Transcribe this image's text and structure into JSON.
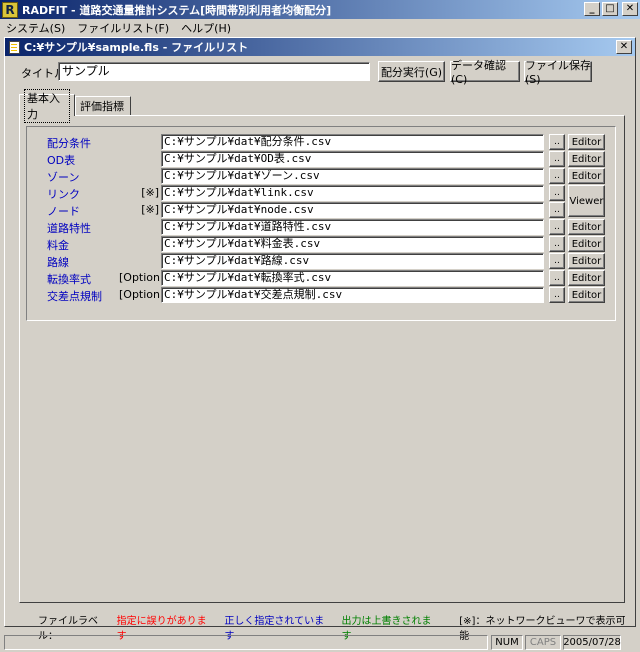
{
  "window": {
    "app_icon": "R",
    "title": "RADFIT - 道路交通量推計システム[時間帯別利用者均衡配分]",
    "controls": {
      "minimize": "_",
      "maximize": "□",
      "close": "✕"
    }
  },
  "menu": [
    {
      "label": "システム(S)"
    },
    {
      "label": "ファイルリスト(F)"
    },
    {
      "label": "ヘルプ(H)"
    }
  ],
  "child": {
    "title": "C:¥サンプル¥sample.fls - ファイルリスト",
    "close": "✕"
  },
  "form": {
    "title_label": "タイトル",
    "title_value": "サンプル",
    "buttons": {
      "run": "配分実行(G)",
      "check": "データ確認(C)",
      "save": "ファイル保存(S)"
    }
  },
  "tabs": [
    {
      "label": "基本入力",
      "active": true
    },
    {
      "label": "評価指標",
      "active": false
    }
  ],
  "files": [
    {
      "label": "配分条件",
      "mark": "",
      "path": "C:¥サンプル¥dat¥配分条件.csv",
      "browse": "..",
      "editor": "Editor"
    },
    {
      "label": "OD表",
      "mark": "",
      "path": "C:¥サンプル¥dat¥OD表.csv",
      "browse": "..",
      "editor": "Editor"
    },
    {
      "label": "ゾーン",
      "mark": "",
      "path": "C:¥サンプル¥dat¥ゾーン.csv",
      "browse": "..",
      "editor": "Editor"
    },
    {
      "label": "リンク",
      "mark": "[※]",
      "path": "C:¥サンプル¥dat¥link.csv",
      "browse": "..",
      "editor": ""
    },
    {
      "label": "ノード",
      "mark": "[※]",
      "path": "C:¥サンプル¥dat¥node.csv",
      "browse": "..",
      "editor": ""
    },
    {
      "label": "道路特性",
      "mark": "",
      "path": "C:¥サンプル¥dat¥道路特性.csv",
      "browse": "..",
      "editor": "Editor"
    },
    {
      "label": "料金",
      "mark": "",
      "path": "C:¥サンプル¥dat¥料金表.csv",
      "browse": "..",
      "editor": "Editor"
    },
    {
      "label": "路線",
      "mark": "",
      "path": "C:¥サンプル¥dat¥路線.csv",
      "browse": "..",
      "editor": "Editor"
    },
    {
      "label": "転換率式",
      "mark": "[Option]",
      "path": "C:¥サンプル¥dat¥転換率式.csv",
      "browse": "..",
      "editor": "Editor"
    },
    {
      "label": "交差点規制",
      "mark": "[Option]",
      "path": "C:¥サンプル¥dat¥交差点規制.csv",
      "browse": "..",
      "editor": "Editor"
    }
  ],
  "viewer_label": "Viewer",
  "legend": {
    "prefix": "ファイルラベル：",
    "error": "指定に誤りがあります",
    "ok": "正しく指定されています",
    "overwrite": "出力は上書きされます",
    "note": "[※]：ネットワークビューワで表示可能",
    "colors": {
      "error": "#ff0000",
      "ok": "#0000c0",
      "overwrite": "#008000"
    }
  },
  "status": {
    "num": "NUM",
    "caps": "CAPS",
    "date": "2005/07/28"
  }
}
